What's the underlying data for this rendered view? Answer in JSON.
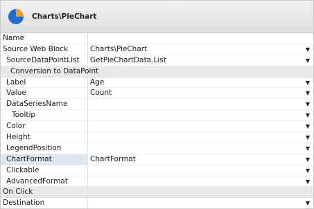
{
  "header": {
    "title": "Charts\\PieChart"
  },
  "rows": [
    {
      "name": "Name",
      "value": "",
      "dropdown": false
    },
    {
      "name": "Source Web Block",
      "value": "Charts\\PieChart",
      "dropdown": true
    },
    {
      "name": "SourceDataPointList",
      "value": "GetPieChartData.List",
      "dropdown": true
    },
    {
      "name": "Conversion to DataPoint",
      "value": "",
      "section": true
    },
    {
      "name": "Label",
      "value": "Age",
      "dropdown": true
    },
    {
      "name": "Value",
      "value": "Count",
      "dropdown": true
    },
    {
      "name": "DataSeriesName",
      "value": "",
      "dropdown": true
    },
    {
      "name": "Tooltip",
      "value": "",
      "dropdown": true
    },
    {
      "name": "Color",
      "value": "",
      "dropdown": true
    },
    {
      "name": "Height",
      "value": "",
      "dropdown": true
    },
    {
      "name": "LegendPosition",
      "value": "",
      "dropdown": true
    },
    {
      "name": "ChartFormat",
      "value": "ChartFormat",
      "dropdown": true,
      "highlight": true
    },
    {
      "name": "Clickable",
      "value": "",
      "dropdown": true
    },
    {
      "name": "AdvancedFormat",
      "value": "",
      "dropdown": true
    },
    {
      "name": "On Click",
      "value": "",
      "section": true
    },
    {
      "name": "Destination",
      "value": "",
      "dropdown": true
    }
  ],
  "icons": {
    "header": "pie-chart-icon",
    "dropdown": "dropdown-arrow-icon"
  },
  "colors": {
    "pie_blue": "#1f6fd1",
    "pie_orange": "#f59a1c",
    "highlight": "#dbe7f3",
    "section_bg": "#e9e9e9"
  }
}
